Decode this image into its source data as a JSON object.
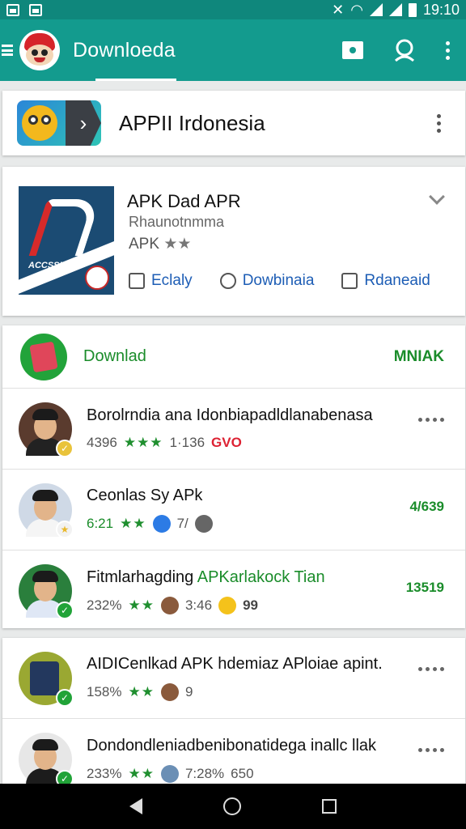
{
  "status_bar": {
    "time": "19:10"
  },
  "app_bar": {
    "title": "Downloeda"
  },
  "header_card": {
    "title": "APPII Irdonesia"
  },
  "featured_app": {
    "name": "APK Dad APR",
    "subtitle": "Rhaunotnmma",
    "rating_text": "APK",
    "rating_stars": "★★",
    "icon_text": "ACCSSISIA",
    "actions": [
      {
        "label": "Eclaly"
      },
      {
        "label": "Dowbinaia"
      },
      {
        "label": "Rdaneaid"
      }
    ]
  },
  "download_row": {
    "label": "Downlad",
    "right_label": "MNIAK"
  },
  "list_items": [
    {
      "title": "Borolrndia ana Idonbiapadldlanabenasa",
      "meta1": "4396",
      "stars": "★★★",
      "meta2": "1·136",
      "meta3": "GVO",
      "right_type": "menu",
      "right": ""
    },
    {
      "title": "Ceonlas Sy APk",
      "meta1": "6:21",
      "stars": "★★",
      "meta2": "7/",
      "meta3": "",
      "right_type": "number",
      "right": "4/639"
    },
    {
      "title": "Fitmlarhagding",
      "title_green": "APKarlakock Tian",
      "meta1": "232%",
      "stars": "★★",
      "meta2": "3:46",
      "meta3": "99",
      "right_type": "number",
      "right": "13519"
    }
  ],
  "list_items2": [
    {
      "title": "AIDICenlkad APK hdemiaz APloiae apint.",
      "meta1": "158%",
      "stars": "★★",
      "meta2": "9",
      "right_type": "menu"
    },
    {
      "title": "Dondondleniadbenibonatidega inallc llak",
      "meta1": "233%",
      "stars": "★★",
      "meta2": "7:28%",
      "meta3": "650",
      "right_type": "menu"
    }
  ],
  "colors": {
    "primary": "#139b8e",
    "status": "#0f877c",
    "accent_green": "#1a8c2a",
    "link_blue": "#1d5db5"
  }
}
